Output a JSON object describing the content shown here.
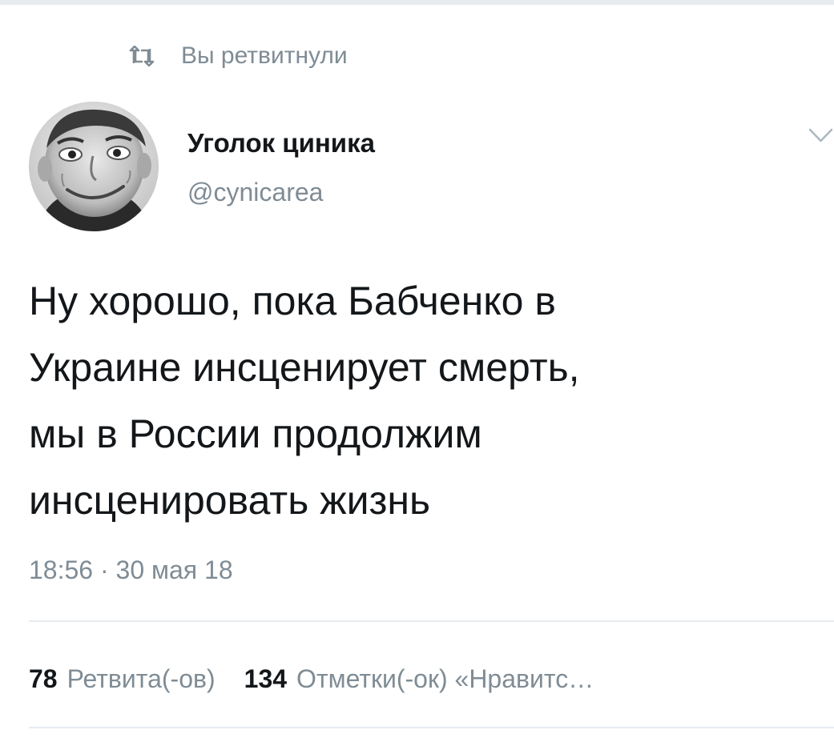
{
  "retweet_context": {
    "icon": "retweet-icon",
    "label": "Вы ретвитнули"
  },
  "author": {
    "name": "Уголок циника",
    "handle": "@cynicarea",
    "avatar": "avatar-photo"
  },
  "menu": {
    "icon": "chevron-down-icon"
  },
  "tweet": {
    "lines": [
      "Ну хорошо, пока Бабченко в",
      "Украине инсценирует смерть,",
      "мы в России продолжим",
      "инсценировать жизнь"
    ],
    "timestamp": "18:56 · 30 мая 18"
  },
  "stats": {
    "retweets_count": "78",
    "retweets_label": "Ретвита(-ов)",
    "likes_count": "134",
    "likes_label": "Отметки(-ок) «Нравитс…"
  },
  "colors": {
    "text_primary": "#14171a",
    "text_secondary": "#7f8c95",
    "divider": "#e6ecf0"
  }
}
